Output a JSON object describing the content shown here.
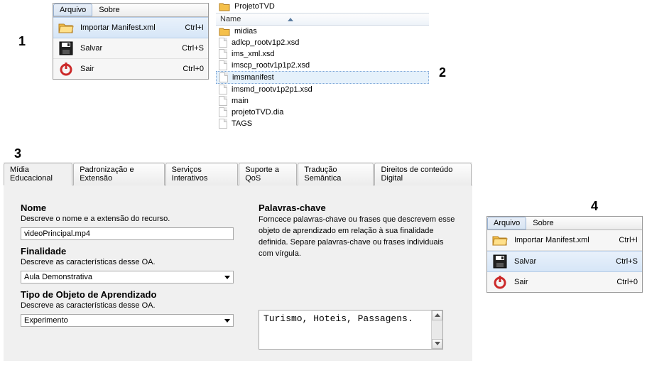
{
  "menu1": {
    "tabs": {
      "arquivo": "Arquivo",
      "sobre": "Sobre"
    },
    "items": [
      {
        "label": "Importar Manifest.xml",
        "shortcut": "Ctrl+I"
      },
      {
        "label": "Salvar",
        "shortcut": "Ctrl+S"
      },
      {
        "label": "Sair",
        "shortcut": "Ctrl+0"
      }
    ]
  },
  "browser": {
    "path": "ProjetoTVD",
    "header": "Name",
    "rows": [
      {
        "name": "midias",
        "type": "folder"
      },
      {
        "name": "adlcp_rootv1p2.xsd",
        "type": "file"
      },
      {
        "name": "ims_xml.xsd",
        "type": "file"
      },
      {
        "name": "imscp_rootv1p1p2.xsd",
        "type": "file"
      },
      {
        "name": "imsmanifest",
        "type": "file",
        "selected": true
      },
      {
        "name": "imsmd_rootv1p2p1.xsd",
        "type": "file"
      },
      {
        "name": "main",
        "type": "file"
      },
      {
        "name": "projetoTVD.dia",
        "type": "file"
      },
      {
        "name": "TAGS",
        "type": "file"
      }
    ]
  },
  "form": {
    "tabs": [
      "Mídia Educacional",
      "Padronização e Extensão",
      "Serviços Interativos",
      "Suporte a QoS",
      "Tradução Semântica",
      "Direitos de conteúdo Digital"
    ],
    "nome": {
      "title": "Nome",
      "desc": "Descreve o nome e a extensão do recurso.",
      "value": "videoPrincipal.mp4"
    },
    "finalidade": {
      "title": "Finalidade",
      "desc": "Descreve as características desse OA.",
      "value": "Aula Demonstrativa"
    },
    "tipo": {
      "title": "Tipo de Objeto de Aprendizado",
      "desc": "Descreve as características desse OA.",
      "value": "Experimento"
    },
    "palavras": {
      "title": "Palavras-chave",
      "desc": "Forncece palavras-chave ou frases que descrevem esse objeto de aprendizado em relação à sua finalidade definida. Separe palavras-chave ou frases individuais com vírgula.",
      "value": "Turismo, Hoteis, Passagens."
    }
  },
  "menu4": {
    "tabs": {
      "arquivo": "Arquivo",
      "sobre": "Sobre"
    },
    "items": [
      {
        "label": "Importar Manifest.xml",
        "shortcut": "Ctrl+I"
      },
      {
        "label": "Salvar",
        "shortcut": "Ctrl+S"
      },
      {
        "label": "Sair",
        "shortcut": "Ctrl+0"
      }
    ]
  },
  "labels": {
    "n1": "1",
    "n2": "2",
    "n3": "3",
    "n4": "4"
  }
}
